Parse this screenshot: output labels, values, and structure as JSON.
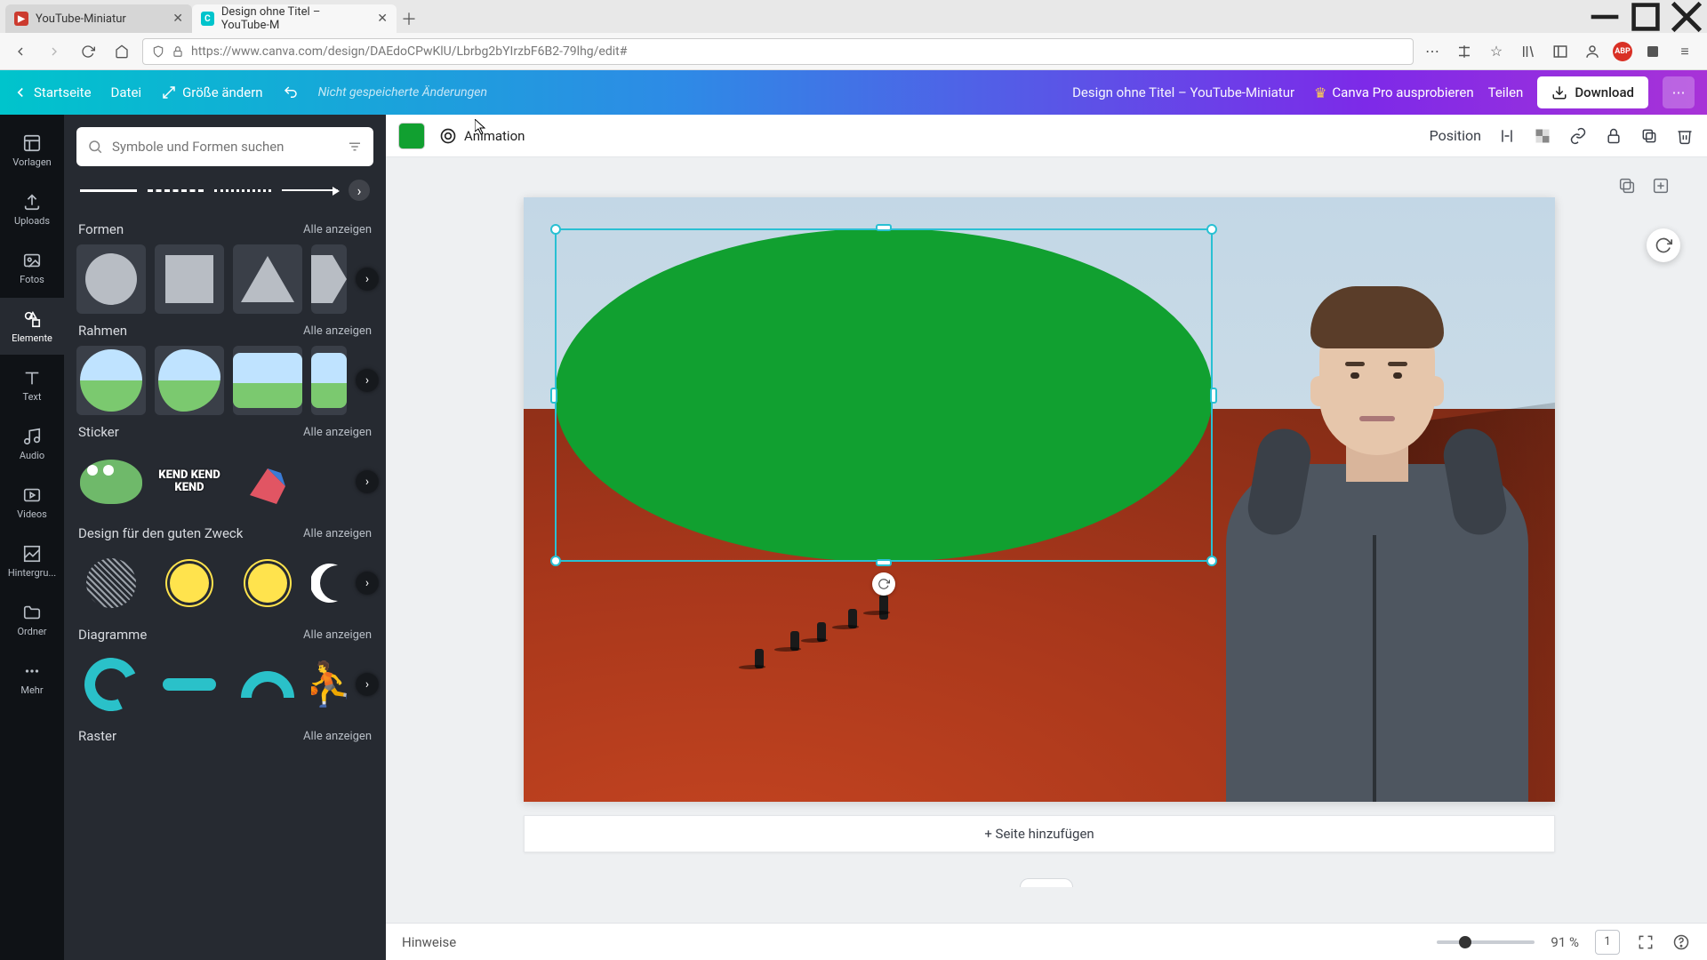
{
  "browser": {
    "tabs": [
      {
        "title": "YouTube-Miniatur",
        "active": false
      },
      {
        "title": "Design ohne Titel – YouTube-M",
        "active": true
      }
    ],
    "url": "https://www.canva.com/design/DAEdoCPwKlU/Lbrbg2bYIrzbF6B2-79lhg/edit#"
  },
  "header": {
    "home": "Startseite",
    "file": "Datei",
    "resize": "Größe ändern",
    "status": "Nicht gespeicherte Änderungen",
    "doc_title": "Design ohne Titel – YouTube-Miniatur",
    "pro": "Canva Pro ausprobieren",
    "share": "Teilen",
    "download": "Download"
  },
  "rail": {
    "templates": "Vorlagen",
    "uploads": "Uploads",
    "photos": "Fotos",
    "elements": "Elemente",
    "text": "Text",
    "audio": "Audio",
    "videos": "Videos",
    "background": "Hintergru...",
    "folders": "Ordner",
    "more": "Mehr"
  },
  "panel": {
    "search_placeholder": "Symbole und Formen suchen",
    "all": "Alle anzeigen",
    "sections": {
      "shapes": "Formen",
      "frames": "Rahmen",
      "stickers": "Sticker",
      "cause": "Design für den guten Zweck",
      "charts": "Diagramme",
      "grid": "Raster"
    },
    "sticker_text": "KEND\nKEND\nKEND"
  },
  "context": {
    "animation": "Animation",
    "position": "Position",
    "selected_color": "#11a030"
  },
  "canvas": {
    "add_page": "+ Seite hinzufügen"
  },
  "footer": {
    "notes": "Hinweise",
    "zoom_pct": "91 %",
    "page_num": "1"
  }
}
